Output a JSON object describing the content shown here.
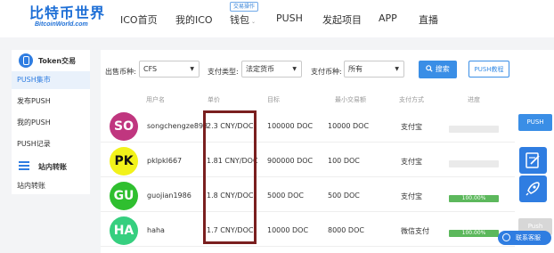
{
  "header": {
    "logo_main": "比特币世界",
    "logo_sub": "BitcoinWorld.com",
    "nav": [
      "ICO首页",
      "我的ICO",
      "钱包",
      "PUSH",
      "发起项目",
      "APP",
      "直播"
    ],
    "wallet_badge": "交易操作",
    "wallet_arrow": "⌄"
  },
  "sidebar": {
    "section1_title": "Token交易",
    "items": [
      "PUSH集市",
      "发布PUSH",
      "我的PUSH",
      "PUSH记录"
    ],
    "section2_title": "站内转账",
    "section2_items": [
      "站内转账"
    ]
  },
  "filters": {
    "coin_label": "出售币种:",
    "coin_value": "CFS",
    "paytype_label": "支付类型:",
    "paytype_value": "法定货币",
    "paycoin_label": "支付币种:",
    "paycoin_value": "所有",
    "search_label": "搜索",
    "tutorial_label": "PUSH教程",
    "caret": "▼"
  },
  "table": {
    "headers": [
      "用户名",
      "单价",
      "目标",
      "最小交易额",
      "支付方式",
      "进度"
    ],
    "rows": [
      {
        "initials": "SO",
        "avatar_bg": "#c0367f",
        "avatar_fg": "#ffffff",
        "username": "songchengze898",
        "price": "2.3 CNY/DOC",
        "target": "100000 DOC",
        "min": "10000 DOC",
        "pay": "支付宝",
        "progress": 0,
        "progress_text": "",
        "action": "PUSH",
        "action_enabled": true
      },
      {
        "initials": "PK",
        "avatar_bg": "#f2f21a",
        "avatar_fg": "#111111",
        "username": "pklpkl667",
        "price": "1.81 CNY/DOC",
        "target": "900000 DOC",
        "min": "100 DOC",
        "pay": "支付宝",
        "progress": 0,
        "progress_text": "",
        "action": "",
        "action_enabled": true
      },
      {
        "initials": "GU",
        "avatar_bg": "#2fbf2f",
        "avatar_fg": "#ffffff",
        "username": "guojian1986",
        "price": "1.8 CNY/DOC",
        "target": "5000 DOC",
        "min": "500 DOC",
        "pay": "支付宝",
        "progress": 100,
        "progress_text": "100.00%",
        "action": "",
        "action_enabled": true
      },
      {
        "initials": "HA",
        "avatar_bg": "#36cf7f",
        "avatar_fg": "#ffffff",
        "username": "haha",
        "price": "1.7 CNY/DOC",
        "target": "10000 DOC",
        "min": "8000 DOC",
        "pay": "微信支付",
        "progress": 100,
        "progress_text": "100.00%",
        "action": "Push",
        "action_enabled": false
      }
    ]
  },
  "float": {
    "chat_label": "联系客服"
  }
}
